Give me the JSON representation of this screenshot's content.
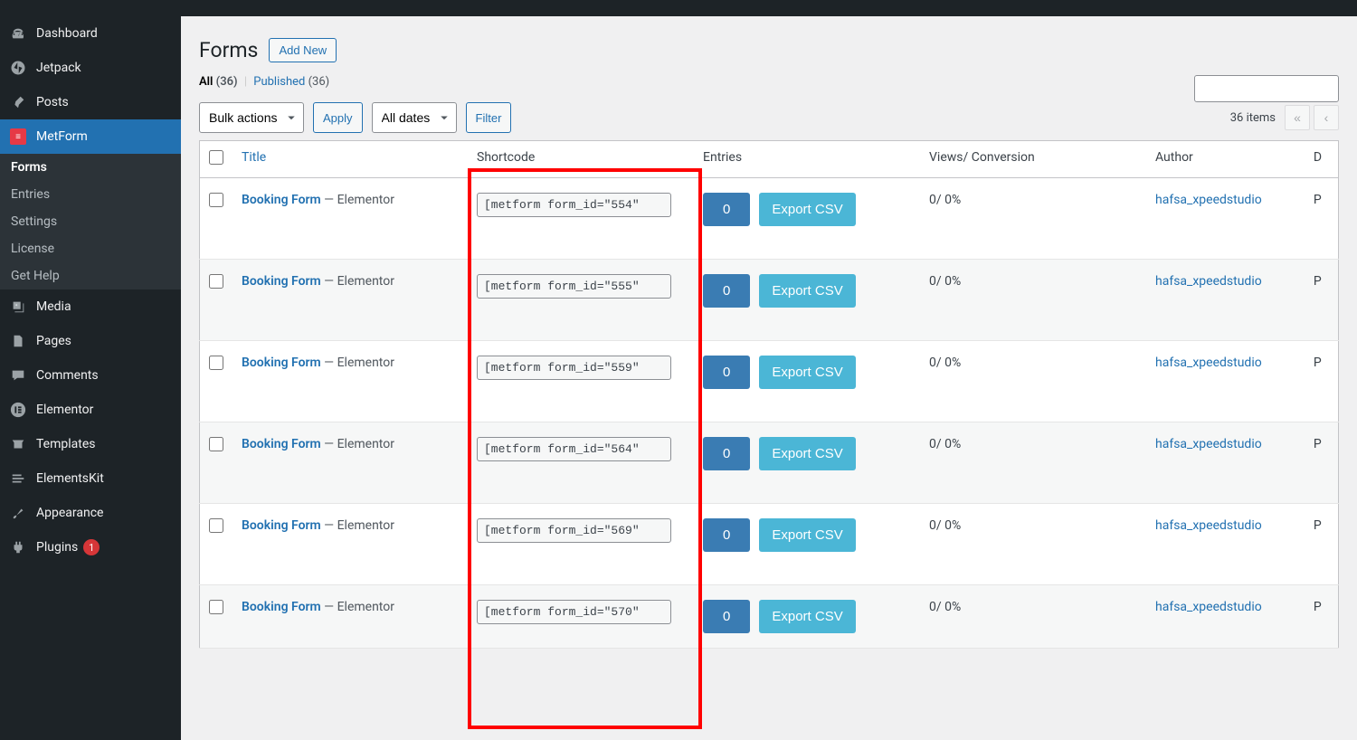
{
  "sidebar": {
    "items": [
      {
        "label": "Dashboard"
      },
      {
        "label": "Jetpack"
      },
      {
        "label": "Posts"
      },
      {
        "label": "MetForm"
      },
      {
        "label": "Media"
      },
      {
        "label": "Pages"
      },
      {
        "label": "Comments"
      },
      {
        "label": "Elementor"
      },
      {
        "label": "Templates"
      },
      {
        "label": "ElementsKit"
      },
      {
        "label": "Appearance"
      },
      {
        "label": "Plugins",
        "badge": "1"
      }
    ],
    "sub": [
      {
        "label": "Forms"
      },
      {
        "label": "Entries"
      },
      {
        "label": "Settings"
      },
      {
        "label": "License"
      },
      {
        "label": "Get Help"
      }
    ]
  },
  "header": {
    "title": "Forms",
    "add_new": "Add New"
  },
  "subsub": {
    "all_label": "All",
    "all_count": "(36)",
    "published_label": "Published",
    "published_count": "(36)"
  },
  "toolbar": {
    "bulk_actions": "Bulk actions",
    "apply": "Apply",
    "all_dates": "All dates",
    "filter": "Filter",
    "items_text": "36 items"
  },
  "table": {
    "headers": {
      "title": "Title",
      "shortcode": "Shortcode",
      "entries": "Entries",
      "views": "Views/ Conversion",
      "author": "Author",
      "date": "D"
    },
    "rows": [
      {
        "title": "Booking Form",
        "suffix": " — Elementor",
        "shortcode": "[metform form_id=\"554\"",
        "entries": "0",
        "export": "Export CSV",
        "views": "0/ 0%",
        "author": "hafsa_xpeedstudio",
        "date": "P"
      },
      {
        "title": "Booking Form",
        "suffix": " — Elementor",
        "shortcode": "[metform form_id=\"555\"",
        "entries": "0",
        "export": "Export CSV",
        "views": "0/ 0%",
        "author": "hafsa_xpeedstudio",
        "date": "P"
      },
      {
        "title": "Booking Form",
        "suffix": " — Elementor",
        "shortcode": "[metform form_id=\"559\"",
        "entries": "0",
        "export": "Export CSV",
        "views": "0/ 0%",
        "author": "hafsa_xpeedstudio",
        "date": "P"
      },
      {
        "title": "Booking Form",
        "suffix": " — Elementor",
        "shortcode": "[metform form_id=\"564\"",
        "entries": "0",
        "export": "Export CSV",
        "views": "0/ 0%",
        "author": "hafsa_xpeedstudio",
        "date": "P"
      },
      {
        "title": "Booking Form",
        "suffix": " — Elementor",
        "shortcode": "[metform form_id=\"569\"",
        "entries": "0",
        "export": "Export CSV",
        "views": "0/ 0%",
        "author": "hafsa_xpeedstudio",
        "date": "P"
      },
      {
        "title": "Booking Form",
        "suffix": " — Elementor",
        "shortcode": "[metform form_id=\"570\"",
        "entries": "0",
        "export": "Export CSV",
        "views": "0/ 0%",
        "author": "hafsa_xpeedstudio",
        "date": "P"
      }
    ]
  }
}
